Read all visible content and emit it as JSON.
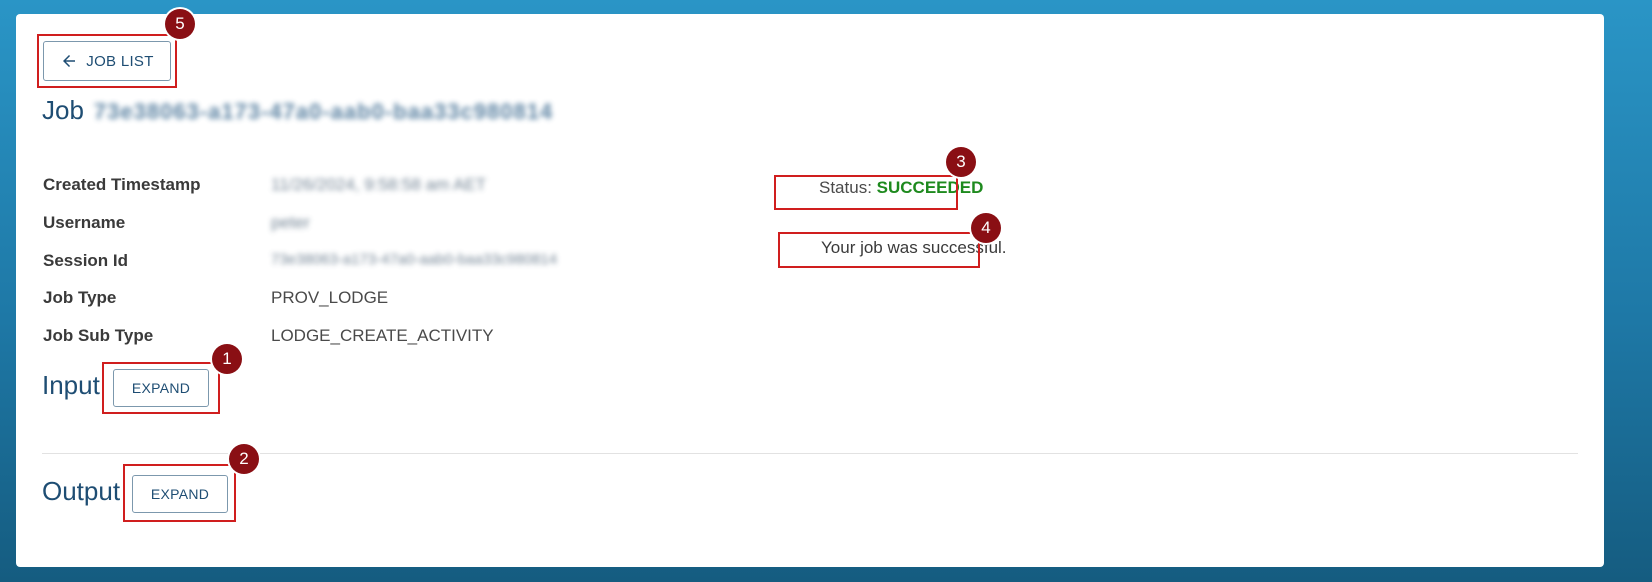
{
  "nav": {
    "back_label": "JOB LIST",
    "back_icon": "arrow-left-icon"
  },
  "job": {
    "title_prefix": "Job",
    "id": "73e38063-a173-47a0-aab0-baa33c980814"
  },
  "details": [
    {
      "label": "Created Timestamp",
      "value": "11/26/2024, 9:58:58 am AET",
      "obscured": true
    },
    {
      "label": "Username",
      "value": "peter",
      "obscured": true
    },
    {
      "label": "Session Id",
      "value": "73e38063-a173-47a0-aab0-baa33c980814",
      "obscured": true
    },
    {
      "label": "Job Type",
      "value": "PROV_LODGE",
      "obscured": false
    },
    {
      "label": "Job Sub Type",
      "value": "LODGE_CREATE_ACTIVITY",
      "obscured": false
    }
  ],
  "status": {
    "prefix": "Status:",
    "value": "SUCCEEDED",
    "message": "Your job was successful.",
    "color": "#1e8a1e"
  },
  "input": {
    "title": "Input",
    "expand_label": "EXPAND"
  },
  "output": {
    "title": "Output",
    "expand_label": "EXPAND"
  },
  "annotations": [
    {
      "number": "1",
      "target": "input-expand-button"
    },
    {
      "number": "2",
      "target": "output-expand-button"
    },
    {
      "number": "3",
      "target": "status-line"
    },
    {
      "number": "4",
      "target": "success-message"
    },
    {
      "number": "5",
      "target": "job-list-button"
    }
  ],
  "colors": {
    "accent": "#1e4d73",
    "highlight": "#d01e1e",
    "badge": "#8a0f14"
  }
}
